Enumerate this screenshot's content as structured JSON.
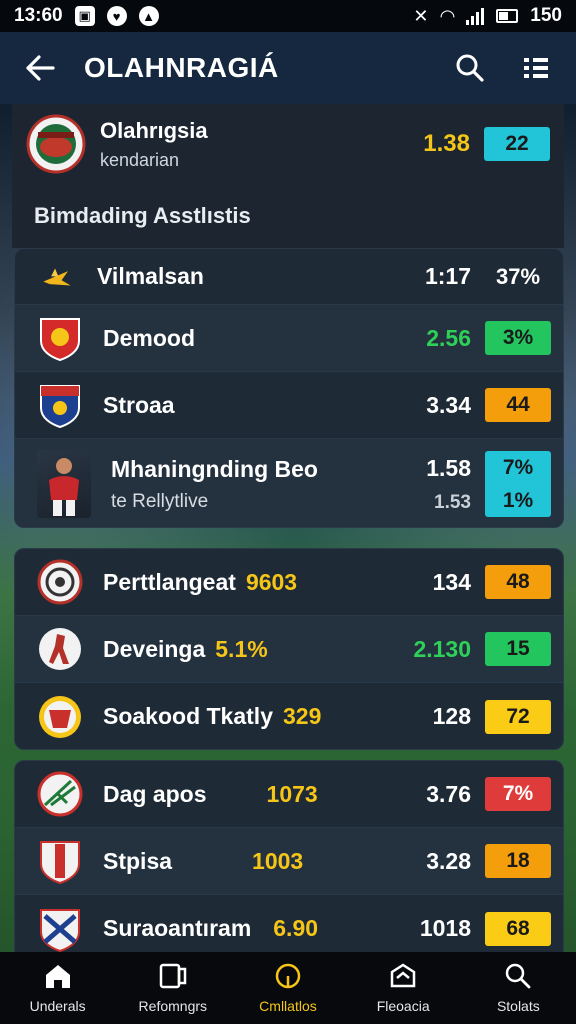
{
  "status_bar": {
    "time": "13:60",
    "battery": "150"
  },
  "header": {
    "title": "OLAHNRAGIÁ"
  },
  "featured": {
    "name": "Olahrıgsia",
    "subtitle": "kendarian",
    "odds": "1.38",
    "badge": "22"
  },
  "section": {
    "label": "Bimdading Asstlıstis"
  },
  "card1": {
    "header_row": {
      "team": "Vilmalsan",
      "odds": "1:17",
      "pct": "37%"
    },
    "rows": [
      {
        "team": "Demood",
        "odds": "2.56",
        "badge": "3%",
        "odds_color": "#2ed158",
        "badge_color": "#22c55e"
      },
      {
        "team": "Stroaa",
        "odds": "3.34",
        "badge": "44",
        "odds_color": "#ffffff",
        "badge_color": "#f59e0b"
      }
    ],
    "tall_row": {
      "team": "Mhaningnding Beo",
      "subtitle": "te Rellytlive",
      "odds_top": "1.58",
      "odds_bottom": "1.53",
      "badge_top": "7%",
      "badge_bottom": "1%"
    }
  },
  "card2": {
    "rows": [
      {
        "team": "Perttlangeat",
        "mid": "9603",
        "odds": "134",
        "badge": "48",
        "odds_color": "#ffffff",
        "badge_color": "#f59e0b"
      },
      {
        "team": "Deveinga",
        "mid": "5.1%",
        "odds": "2.130",
        "badge": "15",
        "odds_color": "#2ed158",
        "badge_color": "#22c55e"
      },
      {
        "team": "Soakood Tkatly",
        "mid": "329",
        "odds": "128",
        "badge": "72",
        "odds_color": "#ffffff",
        "badge_color": "#facc15"
      }
    ]
  },
  "card3": {
    "rows": [
      {
        "team": "Dag apos",
        "mid": "1073",
        "odds": "3.76",
        "badge": "7%",
        "odds_color": "#ffffff",
        "badge_color": "#e03b3b"
      },
      {
        "team": "Stpisa",
        "mid": "1003",
        "odds": "3.28",
        "badge": "18",
        "odds_color": "#ffffff",
        "badge_color": "#f59e0b"
      },
      {
        "team": "Suraoantıram",
        "mid": "6.90",
        "odds": "1018",
        "badge": "68",
        "odds_color": "#ffffff",
        "badge_color": "#facc15"
      }
    ]
  },
  "bottom_nav": {
    "items": [
      {
        "label": "Underals",
        "icon": "home-icon"
      },
      {
        "label": "Refomngrs",
        "icon": "tablet-icon"
      },
      {
        "label": "Cmllatlos",
        "icon": "circle-icon"
      },
      {
        "label": "Fleoacia",
        "icon": "shield-icon"
      },
      {
        "label": "Stolats",
        "icon": "search-icon"
      }
    ]
  }
}
